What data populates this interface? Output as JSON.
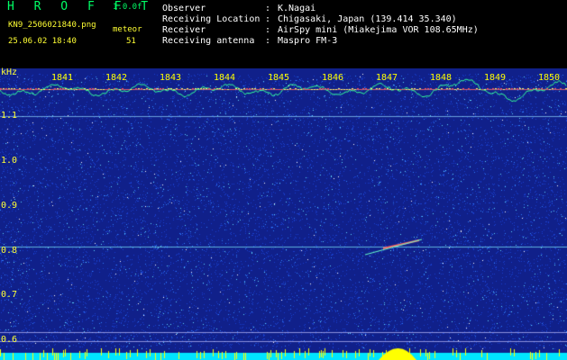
{
  "header": {
    "title": "H R O F F T",
    "version": "1.0.0f",
    "filename": "KN9_2506021840.png",
    "timestamp": "25.06.02 18:40",
    "meteor_label": "meteor",
    "meteor_count": "51"
  },
  "info": [
    {
      "label": "Observer",
      "value": "K.Nagai"
    },
    {
      "label": "Receiving Location",
      "value": "Chigasaki, Japan (139.414 35.340)"
    },
    {
      "label": "Receiver",
      "value": "AirSpy mini (Miakejima VOR 108.65MHz)"
    },
    {
      "label": "Receiving antenna",
      "value": "Maspro FM-3"
    }
  ],
  "colors": {
    "background": "#000000",
    "spectrogram_base": "#10208a",
    "header_green": "#00ff66",
    "label_yellow": "#ffff33",
    "trace_green": "#33ff99",
    "bottom_band": "#00e5ff",
    "signal_red": "#ff5555"
  },
  "spectrogram": {
    "y_unit": "kHz",
    "y_ticks": [
      "1.1",
      "1.0",
      "0.9",
      "0.8",
      "0.7",
      "0.6"
    ],
    "x_ticks": [
      "1841",
      "1842",
      "1843",
      "1844",
      "1845",
      "1846",
      "1847",
      "1848",
      "1849",
      "1850"
    ]
  }
}
